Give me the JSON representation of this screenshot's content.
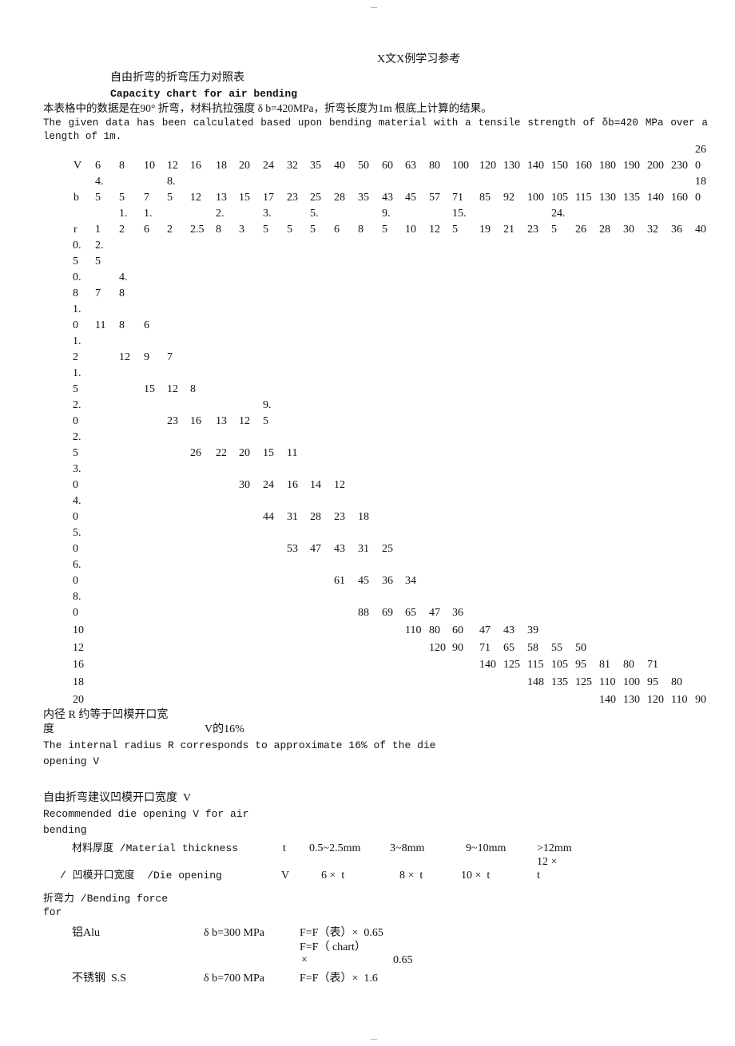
{
  "page_marks": {
    "top": "—",
    "bottom": "—"
  },
  "header_note": "X文X例学习参考",
  "title_cn": "自由折弯的折弯压力对照表",
  "title_en": "Capacity chart for air bending",
  "intro_cn": "本表格中的数据是在90° 折弯，材料抗拉强度 δ b=420MPa，折弯长度为1m 根底上计算的结果。",
  "intro_en": "The given data has been calculated based upon bending material with a tensile strength of δb=420 MPa over a length of 1m.",
  "table": {
    "header_rows": [
      {
        "label": "V",
        "values": [
          "6",
          "8",
          "10",
          "12",
          "16",
          "18",
          "20",
          "24",
          "32",
          "35",
          "40",
          "50",
          "60",
          "63",
          "80",
          "100",
          "120",
          "130",
          "140",
          "150",
          "160",
          "180",
          "190",
          "200",
          "230",
          "26\n0"
        ]
      },
      {
        "label": "b",
        "values": [
          "4.\n5",
          "5",
          "7",
          "8.\n5",
          "12",
          "13",
          "15",
          "17",
          "23",
          "25",
          "28",
          "35",
          "43",
          "45",
          "57",
          "71",
          "85",
          "92",
          "100",
          "105",
          "115",
          "130",
          "135",
          "140",
          "160",
          "18\n0"
        ]
      },
      {
        "label": "r",
        "values": [
          "1",
          "1.\n2",
          "1.\n6",
          "2",
          "2.5",
          "2.\n8",
          "3",
          "3.\n5",
          "5",
          "5.\n5",
          "6",
          "8",
          "9.\n5",
          "10",
          "12",
          "15.\n5",
          "19",
          "21",
          "23",
          "24.\n5",
          "26",
          "28",
          "30",
          "32",
          "36",
          "40"
        ]
      }
    ],
    "body_rows": [
      {
        "label": "0.\n5",
        "start": 1,
        "values": [
          "2.\n5"
        ]
      },
      {
        "label": "0.\n8",
        "start": 1,
        "values": [
          "7",
          "4.\n8"
        ]
      },
      {
        "label": "1.\n0",
        "start": 1,
        "values": [
          "11",
          "8",
          "6"
        ]
      },
      {
        "label": "1.\n2",
        "start": 2,
        "values": [
          "12",
          "9",
          "7"
        ]
      },
      {
        "label": "1.\n5",
        "start": 3,
        "values": [
          "15",
          "12",
          "8"
        ]
      },
      {
        "label": "2.\n0",
        "start": 4,
        "values": [
          "23",
          "16",
          "13",
          "12",
          "9.\n5"
        ]
      },
      {
        "label": "2.\n5",
        "start": 5,
        "values": [
          "26",
          "22",
          "20",
          "15",
          "11"
        ]
      },
      {
        "label": "3.\n0",
        "start": 7,
        "values": [
          "30",
          "24",
          "16",
          "14",
          "12"
        ]
      },
      {
        "label": "4.\n0",
        "start": 8,
        "values": [
          "44",
          "31",
          "28",
          "23",
          "18"
        ]
      },
      {
        "label": "5.\n0",
        "start": 9,
        "values": [
          "53",
          "47",
          "43",
          "31",
          "25"
        ]
      },
      {
        "label": "6.\n0",
        "start": 11,
        "values": [
          "61",
          "45",
          "36",
          "34"
        ]
      },
      {
        "label": "8.\n0",
        "start": 12,
        "values": [
          "88",
          "69",
          "65",
          "47",
          "36"
        ]
      },
      {
        "label": "10",
        "start": 14,
        "values": [
          "110",
          "80",
          "60",
          "47",
          "43",
          "39"
        ]
      },
      {
        "label": "12",
        "start": 15,
        "values": [
          "120",
          "90",
          "71",
          "65",
          "58",
          "55",
          "50"
        ]
      },
      {
        "label": "16",
        "start": 17,
        "values": [
          "140",
          "125",
          "115",
          "105",
          "95",
          "81",
          "80",
          "71"
        ]
      },
      {
        "label": "18",
        "start": 19,
        "values": [
          "148",
          "135",
          "125",
          "110",
          "100",
          "95",
          "80"
        ]
      },
      {
        "label": "20",
        "start": 22,
        "values": [
          "140",
          "130",
          "120",
          "110",
          "90"
        ]
      }
    ]
  },
  "radius_note": {
    "cn_line1": "内径 R 约等于凹模开口宽",
    "cn_line2": "度",
    "cn_line2b": "V的16%",
    "en_line1": "The internal radius R corresponds to approximate 16% of the die",
    "en_line2": "opening V"
  },
  "die_section": {
    "title_cn": "自由折弯建议凹模开口宽度  V",
    "title_en_1": "Recommended die opening V for air",
    "title_en_2": "bending",
    "thickness_label": "材料厚度 /Material thickness",
    "thickness_symbol": "t",
    "thickness_values": [
      "0.5~2.5mm",
      "3~8mm",
      "9~10mm",
      ">12mm"
    ],
    "die_label": "/ 凹模开口宽度  /Die opening",
    "die_symbol": "V",
    "die_values": [
      "6 ×  t",
      "8 ×  t",
      "10 ×  t",
      "12 ×",
      "t"
    ]
  },
  "force_section": {
    "title_1": "折弯力 /Bending force",
    "title_2": "for",
    "materials": [
      {
        "name": "铝Alu",
        "strength": "δ b=300 MPa",
        "formula_cn": "F=F（表）×  0.65",
        "formula_en_1": "F=F（ chart）",
        "formula_en_2": "×",
        "formula_en_3": "0.65"
      },
      {
        "name": "不锈钢  S.S",
        "strength": "δ b=700 MPa",
        "formula_cn": "F=F（表）×  1.6"
      }
    ]
  }
}
